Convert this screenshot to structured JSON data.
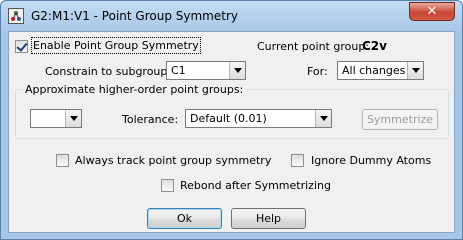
{
  "window": {
    "title": "G2:M1:V1 - Point Group Symmetry",
    "close_glyph": "✕"
  },
  "enable_symmetry": {
    "label": "Enable Point Group Symmetry",
    "checked": true
  },
  "current_point_group": {
    "label": "Current point group:",
    "value": "C2v"
  },
  "constrain": {
    "label": "Constrain to subgroup:",
    "selected": "C1"
  },
  "for_field": {
    "label": "For:",
    "selected": "All changes"
  },
  "approx_group": {
    "label": "Approximate higher-order point groups:",
    "group_select_value": "",
    "tolerance_label": "Tolerance:",
    "tolerance_selected": "Default (0.01)",
    "symmetrize_label": "Symmetrize"
  },
  "options": {
    "always_track": {
      "label": "Always track point group symmetry",
      "checked": false
    },
    "ignore_dummy": {
      "label": "Ignore Dummy Atoms",
      "checked": false
    },
    "rebond": {
      "label": "Rebond after Symmetrizing",
      "checked": false
    }
  },
  "buttons": {
    "ok": "Ok",
    "help": "Help"
  }
}
